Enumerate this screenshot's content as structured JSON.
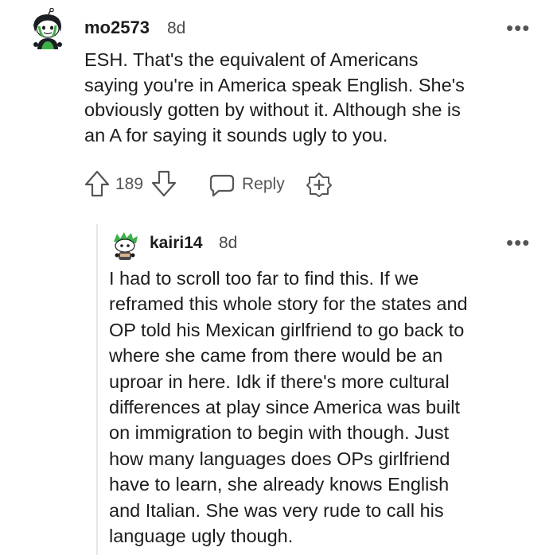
{
  "comment": {
    "username": "mo2573",
    "age": "8d",
    "more_label": "•••",
    "body_lines": [
      "ESH. That's the equivalent of Americans",
      "saying you're in America speak English. She's",
      "obviously gotten by without it. Although she is",
      "an A for saying it sounds ugly to you."
    ],
    "votes": "189",
    "reply_label": "Reply"
  },
  "reply": {
    "username": "kairi14",
    "age": "8d",
    "more_label": "•••",
    "body_lines": [
      "I had to scroll too far to find this. If we",
      "reframed this whole story for the states and",
      "OP told his Mexican girlfriend to go back to",
      "where she came from there would be an",
      "uproar in here. Idk if there's more cultural",
      "differences at play since America was built",
      "on immigration to begin with though. Just",
      "how many languages does OPs girlfriend",
      "have to learn, she already knows English",
      "and Italian. She was very rude to call his",
      "language ugly though."
    ]
  },
  "colors": {
    "text": "#1c1c1c",
    "meta": "#555555",
    "thread_line": "#e7e7e7",
    "avatar_green": "#3fae49"
  }
}
